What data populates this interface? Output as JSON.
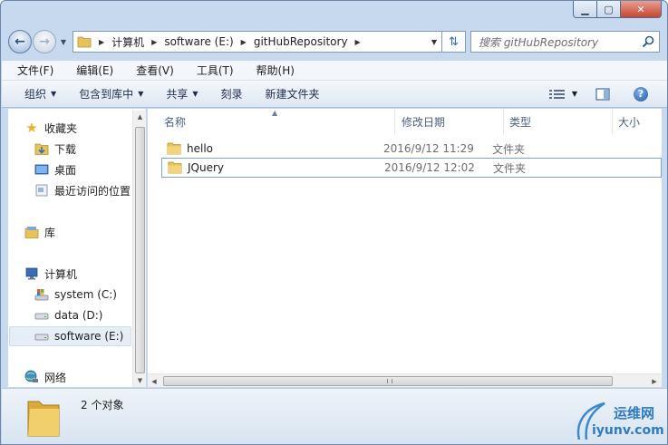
{
  "window": {
    "caption": {
      "minimize": "▁",
      "maximize": "▢",
      "close": "✕"
    }
  },
  "navbar": {
    "breadcrumbs": [
      "计算机",
      "software (E:)",
      "gitHubRepository"
    ],
    "search_placeholder": "搜索 gitHubRepository"
  },
  "menubar": {
    "items": [
      "文件(F)",
      "编辑(E)",
      "查看(V)",
      "工具(T)",
      "帮助(H)"
    ]
  },
  "cmdbar": {
    "items": [
      "组织",
      "包含到库中",
      "共享",
      "刻录",
      "新建文件夹"
    ]
  },
  "navpane": {
    "favorites": "收藏夹",
    "favorites_items": [
      "下载",
      "桌面",
      "最近访问的位置"
    ],
    "libraries": "库",
    "computer": "计算机",
    "drives": [
      "system (C:)",
      "data (D:)",
      "software (E:)"
    ],
    "network": "网络"
  },
  "filelist": {
    "columns": {
      "name": "名称",
      "date": "修改日期",
      "type": "类型",
      "size": "大小"
    },
    "files": [
      {
        "name": "hello",
        "date": "2016/9/12 11:29",
        "type": "文件夹"
      },
      {
        "name": "JQuery",
        "date": "2016/9/12 12:02",
        "type": "文件夹"
      }
    ]
  },
  "details": {
    "count": "2 个对象"
  },
  "watermark": {
    "cn": "运维网",
    "en": "iyunv.com"
  },
  "colors": {
    "folder": "#e8c25a",
    "accent": "#2e7cc2"
  }
}
